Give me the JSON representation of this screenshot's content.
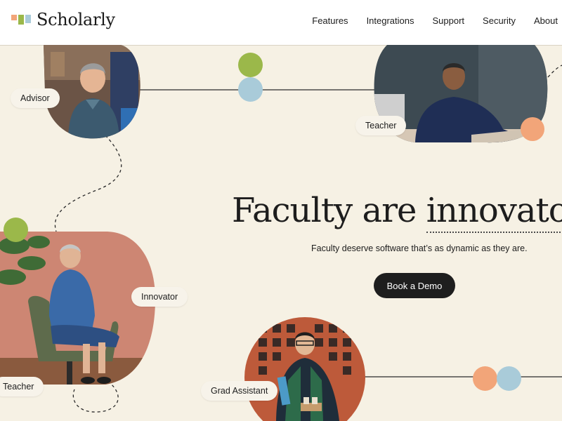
{
  "brand": {
    "name": "Scholarly"
  },
  "nav": {
    "items": [
      "Features",
      "Integrations",
      "Support",
      "Security",
      "About"
    ]
  },
  "hero": {
    "headline": "Faculty are ",
    "headline_accent": "innovators",
    "subtitle": "Faculty deserve software that’s as dynamic as they are.",
    "cta": "Book a Demo"
  },
  "roles": {
    "advisor": "Advisor",
    "teacher_top": "Teacher",
    "innovator": "Innovator",
    "teacher_bottom": "Teacher",
    "grad_assistant": "Grad Assistant"
  },
  "colors": {
    "background": "#f6f1e4",
    "green": "#9bb84a",
    "blue": "#a9cbd9",
    "orange": "#f2a579",
    "cta": "#1e1e1e"
  }
}
